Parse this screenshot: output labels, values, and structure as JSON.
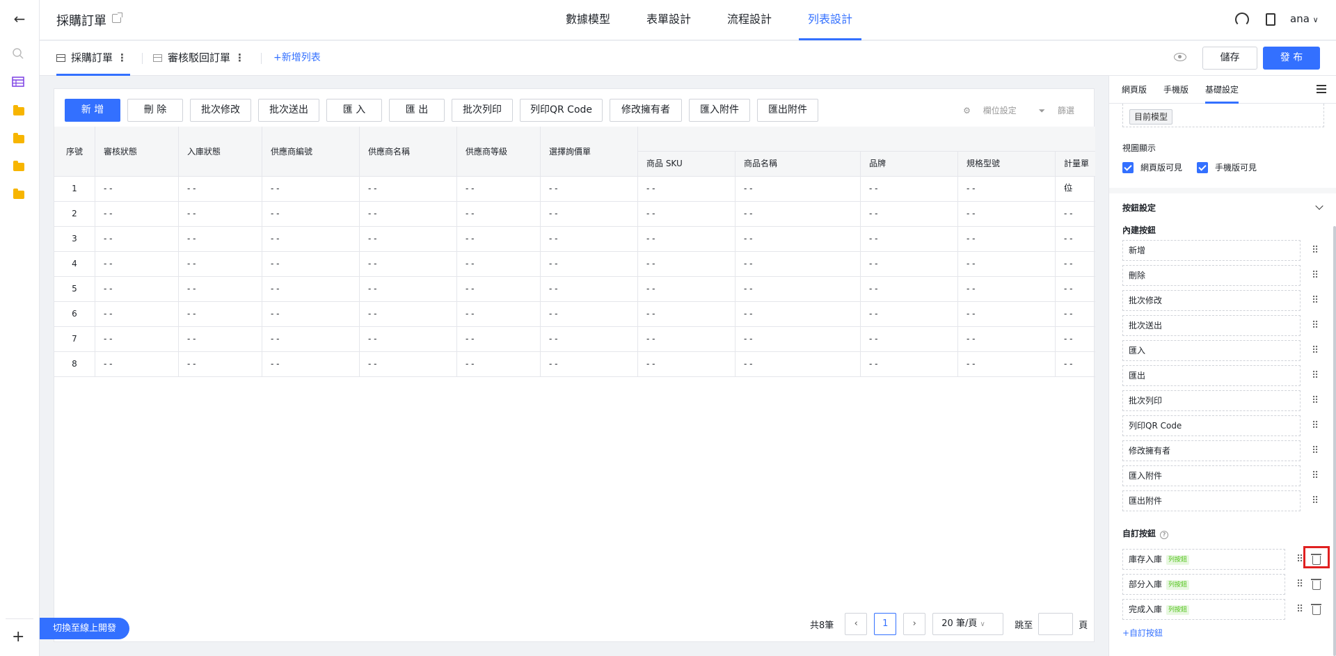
{
  "app": {
    "title": "採購訂單",
    "user": "ana"
  },
  "main_tabs": [
    {
      "label": "數據模型",
      "active": false
    },
    {
      "label": "表單設計",
      "active": false
    },
    {
      "label": "流程設計",
      "active": false
    },
    {
      "label": "列表設計",
      "active": true
    }
  ],
  "list_tabs": [
    {
      "label": "採購訂單",
      "active": true
    },
    {
      "label": "審核駁回訂單",
      "active": false
    }
  ],
  "add_list_label": "+新增列表",
  "header_buttons": {
    "save": "儲存",
    "publish": "發 布"
  },
  "toolbar": {
    "buttons": [
      "新 增",
      "刪 除",
      "批次修改",
      "批次送出",
      "匯 入",
      "匯 出",
      "批次列印",
      "列印QR Code",
      "修改擁有者",
      "匯入附件",
      "匯出附件"
    ],
    "field_settings": "欄位設定",
    "filter": "篩選"
  },
  "table": {
    "columns": [
      "序號",
      "審核狀態",
      "入庫狀態",
      "供應商編號",
      "供應商名稱",
      "供應商等級",
      "選擇詢價單",
      "商品 SKU",
      "商品名稱",
      "品牌",
      "規格型號",
      "計量單位"
    ],
    "row_indices": [
      "1",
      "2",
      "3",
      "4",
      "5",
      "6",
      "7",
      "8"
    ],
    "empty_cell": "- -"
  },
  "pagination": {
    "total": "共8筆",
    "current_page": "1",
    "page_size": "20 筆/頁",
    "jump_label": "跳至",
    "page_suffix": "頁"
  },
  "switch_button": "切換至線上開發",
  "right_panel": {
    "tabs": [
      {
        "label": "網頁版",
        "active": false
      },
      {
        "label": "手機版",
        "active": false
      },
      {
        "label": "基礎設定",
        "active": true
      }
    ],
    "current_model": "目前模型",
    "view_display_label": "視圖顯示",
    "web_visible": "網頁版可見",
    "mobile_visible": "手機版可見",
    "button_settings": "按鈕設定",
    "builtin_buttons_label": "內建按鈕",
    "builtin_buttons": [
      "新增",
      "刪除",
      "批次修改",
      "批次送出",
      "匯入",
      "匯出",
      "批次列印",
      "列印QR Code",
      "修改擁有者",
      "匯入附件",
      "匯出附件"
    ],
    "custom_buttons_label": "自訂按鈕",
    "custom_buttons": [
      {
        "label": "庫存入庫",
        "tag": "列按鈕"
      },
      {
        "label": "部分入庫",
        "tag": "列按鈕"
      },
      {
        "label": "完成入庫",
        "tag": "列按鈕"
      }
    ],
    "add_custom_button": "+自訂按鈕"
  },
  "colors": {
    "accent": "#3370ff",
    "highlight": "#e02020",
    "folder": "#f7b500",
    "tag_green": "#52c41a"
  }
}
